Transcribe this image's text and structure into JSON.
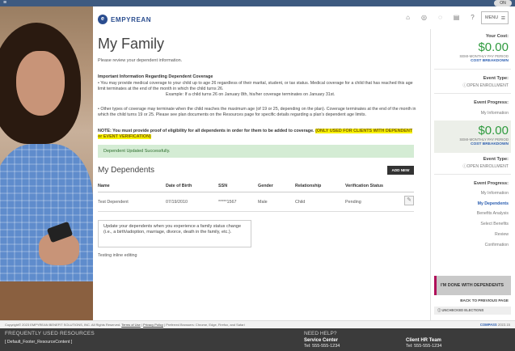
{
  "topbar": {
    "toggle_label": "ON"
  },
  "brand": {
    "logo_text": "EMPYREAN"
  },
  "page": {
    "title": "My Family",
    "subtitle": "Please review your dependent information."
  },
  "info": {
    "heading": "Important Information Regarding Dependent Coverage",
    "bullet1": "• You may provide medical coverage to your child up to age 26 regardless of their marital, student, or tax status. Medical coverage for a child that has reached this age limit terminates at the end of the month in which the child turns 26.",
    "bullet1_example": "Example: If a child turns 26 on January 8th, his/her coverage terminates on January 31st.",
    "bullet2": "• Other types of coverage may terminate when the child reaches the maximum age (of 19 or 25, depending on the plan). Coverage terminates at the end of the month in which the child turns 19 or 25. Please see plan documents on the Resources page for specific details regarding a plan's dependent age limits.",
    "note_plain": "NOTE: You must provide proof of eligibility for all dependents in order for them to be added to coverage.",
    "note_highlight": "(ONLY USED FOR CLIENTS WITH DEPENDENT or EVENT VERIFICATION)"
  },
  "alert": {
    "success": "Dependent Updated Successfully."
  },
  "dependents": {
    "title": "My Dependents",
    "add_label": "ADD NEW",
    "columns": [
      "Name",
      "Date of Birth",
      "SSN",
      "Gender",
      "Relationship",
      "Verification Status"
    ],
    "rows": [
      {
        "name": "Test Dependent",
        "dob": "07/19/2010",
        "ssn": "*****1567",
        "gender": "Male",
        "relationship": "Child",
        "status": "Pending"
      }
    ],
    "help_text": "Update your dependents when you experience a family status change (i.e., a birth/adoption, marriage, divorce, death in the family, etc.).",
    "testing_text": "Testing inline editing"
  },
  "toolbar": {
    "icons": [
      "home-icon",
      "help-circle-icon",
      "chat-icon",
      "calculator-icon",
      "question-icon"
    ],
    "menu_label": "MENU"
  },
  "sidebar": {
    "cost_label": "Your Cost:",
    "cost_value": "$0.00",
    "cost_period": "SEMI-MONTHLY PAY PERIOD",
    "cost_breakdown": "COST BREAKDOWN",
    "event_type_label": "Event Type:",
    "event_type_value": "OPEN ENROLLMENT",
    "event_progress_label": "Event Progress:",
    "progress_first": "My Information",
    "cost2_value": "$0.00",
    "cost2_period": "SEMI-MONTHLY PAY PERIOD",
    "cost2_breakdown": "COST BREAKDOWN",
    "event_type2_label": "Event Type:",
    "event_type2_value": "OPEN ENROLLMENT",
    "event_progress2_label": "Event Progress:",
    "progress_steps": [
      {
        "label": "My Information",
        "active": false
      },
      {
        "label": "My Dependents",
        "active": true
      },
      {
        "label": "Benefits Analysis",
        "active": false
      },
      {
        "label": "Select Benefits",
        "active": false
      },
      {
        "label": "Review",
        "active": false
      },
      {
        "label": "Confirmation",
        "active": false
      }
    ],
    "done_label": "I'M DONE WITH DEPENDENTS",
    "back_label": "BACK TO PREVIOUS PAGE",
    "unchecked_label": "UNCHECKED ELECTIONS"
  },
  "copyright": {
    "text": "Copyright© 2023 EMPYREAN BENEFIT SOLUTIONS, INC. All Rights Reserved.",
    "terms": "Terms of Use",
    "privacy": "Privacy Policy",
    "browsers": "| Preferred Browsers: Chrome, Edge, Firefox, and Safari",
    "brand_tag": "COMPASS",
    "version": "2023.15"
  },
  "footer": {
    "resources_title": "FREQUENTLY USED RESOURCES",
    "resources_content": "[ Default_Footer_ResourceContent ]",
    "help_title": "NEED HELP?",
    "contacts": [
      {
        "name": "Service Center",
        "tel": "Tel: 555-555-1234"
      },
      {
        "name": "Client HR Team",
        "tel": "Tel: 555-555-1234"
      }
    ]
  },
  "colors": {
    "brand_blue": "#2a4d8f",
    "cost_green": "#2e9a3e",
    "highlight_yellow": "#f7f200",
    "success_bg": "#d4ecd4",
    "done_accent": "#b0105a",
    "footer_bg": "#3b3b3b"
  }
}
